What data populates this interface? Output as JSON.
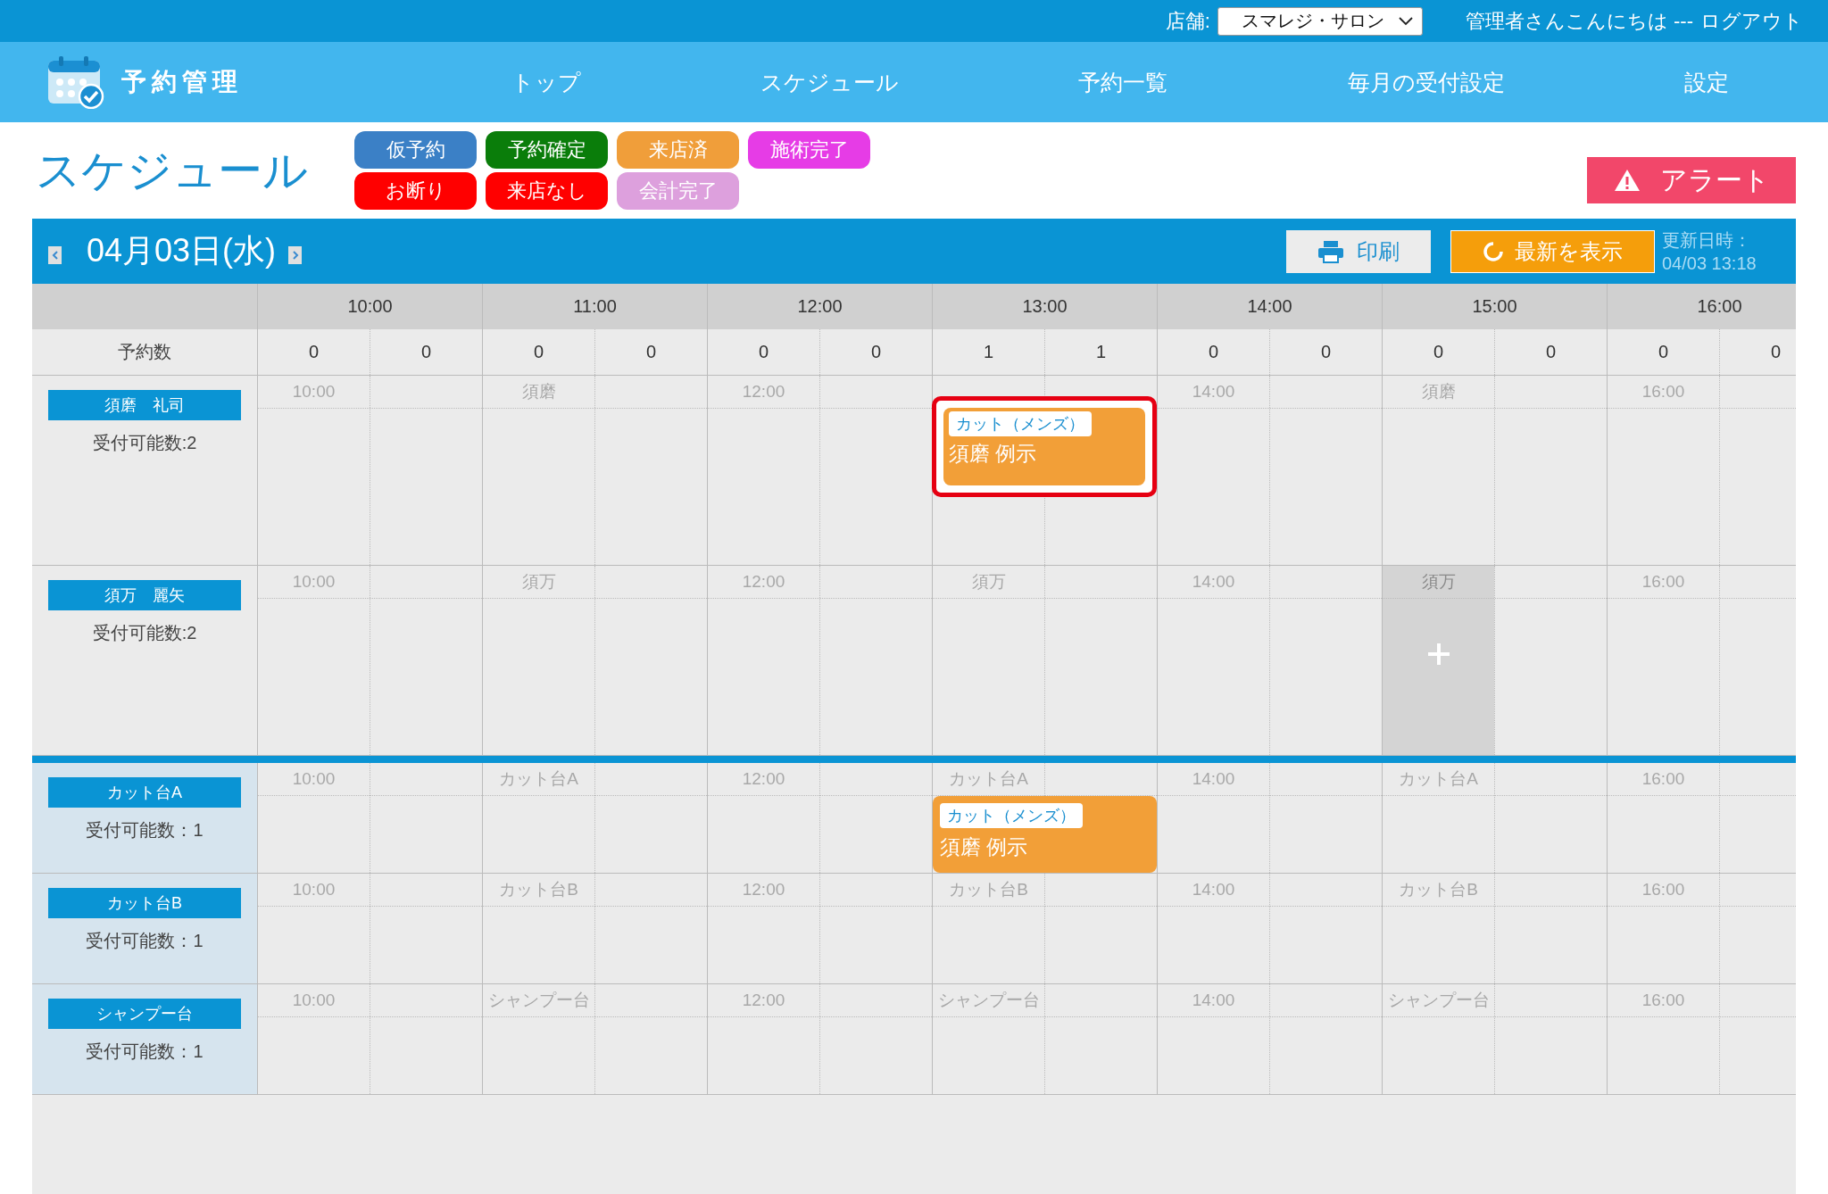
{
  "top_bar": {
    "store_label": "店舗:",
    "store_select": "スマレジ・サロン",
    "greeting": "管理者さんこんにちは ---",
    "logout": "ログアウト"
  },
  "nav": {
    "brand": "予約管理",
    "items": [
      "トップ",
      "スケジュール",
      "予約一覧",
      "毎月の受付設定",
      "設定"
    ]
  },
  "page_title": "スケジュール",
  "legend": [
    {
      "label": "仮予約",
      "color": "#3b80c6"
    },
    {
      "label": "予約確定",
      "color": "#0a7d0a"
    },
    {
      "label": "来店済",
      "color": "#f09e3a"
    },
    {
      "label": "施術完了",
      "color": "#e63ce6"
    },
    {
      "label": "お断り",
      "color": "#ff0000"
    },
    {
      "label": "来店なし",
      "color": "#ff0000"
    },
    {
      "label": "会計完了",
      "color": "#dda0dd"
    }
  ],
  "alert_button": "アラート",
  "date_bar": {
    "date": "04月03日(水)",
    "print_button": "印刷",
    "refresh_button": "最新を表示",
    "updated_label": "更新日時：",
    "updated_value": "04/03 13:18"
  },
  "hours": [
    "10:00",
    "11:00",
    "12:00",
    "13:00",
    "14:00",
    "15:00",
    "16:00"
  ],
  "count_label": "予約数",
  "counts": [
    "0",
    "0",
    "0",
    "0",
    "0",
    "0",
    "1",
    "1",
    "0",
    "0",
    "0",
    "0",
    "0",
    "0"
  ],
  "staff": [
    {
      "name": "須磨　礼司",
      "capacity": "受付可能数:2",
      "slots": [
        {
          "label": "10:00",
          "selected": false
        },
        {
          "selected": false
        },
        {
          "label": "須磨",
          "selected": false
        },
        {
          "selected": false
        },
        {
          "label": "12:00",
          "selected": false
        },
        {
          "selected": false
        },
        {
          "selected": false,
          "booking": {
            "menu": "カット（メンズ）",
            "customer": "須磨 例示",
            "selected": true
          }
        },
        {
          "selected": false
        },
        {
          "label": "14:00",
          "selected": false
        },
        {
          "selected": false
        },
        {
          "label": "須磨",
          "selected": false
        },
        {
          "selected": false
        },
        {
          "label": "16:00",
          "selected": false
        },
        {
          "selected": false
        }
      ]
    },
    {
      "name": "須万　麗矢",
      "capacity": "受付可能数:2",
      "slots": [
        {
          "label": "10:00",
          "selected": false
        },
        {
          "selected": false
        },
        {
          "label": "須万",
          "selected": false
        },
        {
          "selected": false
        },
        {
          "label": "12:00",
          "selected": false
        },
        {
          "selected": false
        },
        {
          "label": "須万",
          "selected": false
        },
        {
          "selected": false
        },
        {
          "label": "14:00",
          "selected": false
        },
        {
          "selected": false
        },
        {
          "label": "須万",
          "selected": true
        },
        {
          "selected": false
        },
        {
          "label": "16:00",
          "selected": false
        },
        {
          "selected": false
        }
      ]
    }
  ],
  "resources": [
    {
      "name": "カット台A",
      "capacity": "受付可能数：1",
      "slots": [
        {
          "label": "10:00",
          "selected": false
        },
        {
          "selected": false
        },
        {
          "label": "カット台A",
          "selected": false
        },
        {
          "selected": false
        },
        {
          "label": "12:00",
          "selected": false
        },
        {
          "selected": false
        },
        {
          "label": "カット台A",
          "selected": false,
          "booking": {
            "menu": "カット（メンズ）",
            "customer": "須磨 例示",
            "selected": false
          }
        },
        {
          "selected": false
        },
        {
          "label": "14:00",
          "selected": false
        },
        {
          "selected": false
        },
        {
          "label": "カット台A",
          "selected": false
        },
        {
          "selected": false
        },
        {
          "label": "16:00",
          "selected": false
        },
        {
          "selected": false
        }
      ]
    },
    {
      "name": "カット台B",
      "capacity": "受付可能数：1",
      "slots": [
        {
          "label": "10:00",
          "selected": false
        },
        {
          "selected": false
        },
        {
          "label": "カット台B",
          "selected": false
        },
        {
          "selected": false
        },
        {
          "label": "12:00",
          "selected": false
        },
        {
          "selected": false
        },
        {
          "label": "カット台B",
          "selected": false
        },
        {
          "selected": false
        },
        {
          "label": "14:00",
          "selected": false
        },
        {
          "selected": false
        },
        {
          "label": "カット台B",
          "selected": false
        },
        {
          "selected": false
        },
        {
          "label": "16:00",
          "selected": false
        },
        {
          "selected": false
        }
      ]
    },
    {
      "name": "シャンプー台",
      "capacity": "受付可能数：1",
      "slots": [
        {
          "label": "10:00",
          "selected": false
        },
        {
          "selected": false
        },
        {
          "label": "シャンプー台",
          "selected": false
        },
        {
          "selected": false
        },
        {
          "label": "12:00",
          "selected": false
        },
        {
          "selected": false
        },
        {
          "label": "シャンプー台",
          "selected": false
        },
        {
          "selected": false
        },
        {
          "label": "14:00",
          "selected": false
        },
        {
          "selected": false
        },
        {
          "label": "シャンプー台",
          "selected": false
        },
        {
          "selected": false
        },
        {
          "label": "16:00",
          "selected": false
        },
        {
          "selected": false
        }
      ]
    }
  ]
}
